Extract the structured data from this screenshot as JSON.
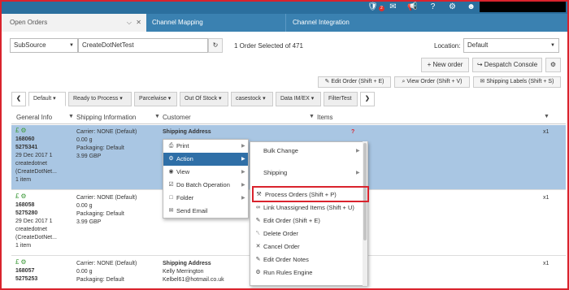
{
  "topbar": {
    "notifications_badge": "2",
    "icons": [
      "notifications-icon",
      "mail-icon",
      "megaphone-icon",
      "help-icon",
      "gear-icon",
      "user-icon"
    ]
  },
  "tabs": [
    {
      "label": "Open Orders"
    },
    {
      "label": "Channel Mapping"
    },
    {
      "label": "Channel Integration"
    }
  ],
  "filters": {
    "field_select": "SubSource",
    "search_value": "CreateDotNetTest",
    "selection_status": "1 Order Selected of 471",
    "location_label": "Location:",
    "location_value": "Default"
  },
  "toolbar": {
    "new_order": "New order",
    "despatch_console": "Despatch Console",
    "edit_order": "Edit Order (Shift + E)",
    "view_order": "View Order (Shift + V)",
    "shipping_labels": "Shipping Labels (Shift + S)"
  },
  "view_tabs": [
    "Default",
    "Ready to Process",
    "Parcelwise",
    "Out Of Stock",
    "casestock",
    "Data IM/EX",
    "FilterTest"
  ],
  "columns": [
    "General Info",
    "Shipping Information",
    "Customer",
    "Items"
  ],
  "orders": [
    {
      "id": "168060",
      "ref": "5275341",
      "date": "29 Dec 2017 1",
      "source": "createdotnet",
      "sub": "(CreateDotNet...",
      "items": "1 item",
      "carrier": "Carrier: NONE (Default)",
      "weight": "0.00 g",
      "packaging": "Packaging: Default",
      "price": "3.99 GBP",
      "customer_title": "Shipping Address",
      "customer_name": "",
      "customer_email": "",
      "qty": "x1"
    },
    {
      "id": "168058",
      "ref": "5275280",
      "date": "29 Dec 2017 1",
      "source": "createdotnet",
      "sub": "(CreateDotNet...",
      "items": "1 item",
      "carrier": "Carrier: NONE (Default)",
      "weight": "0.00 g",
      "packaging": "Packaging: Default",
      "price": "3.99 GBP",
      "customer_title": "",
      "customer_name": "",
      "customer_email": "",
      "qty": "x1"
    },
    {
      "id": "168057",
      "ref": "5275253",
      "date": "",
      "source": "",
      "sub": "",
      "items": "",
      "carrier": "Carrier: NONE (Default)",
      "weight": "0.00 g",
      "packaging": "Packaging: Default",
      "price": "",
      "customer_title": "Shipping Address",
      "customer_name": "Kelly Merrington",
      "customer_email": "Kelbel61@hotmail.co.uk",
      "qty": "x1"
    }
  ],
  "context_menu": [
    {
      "label": "Print",
      "icon": "printer-icon"
    },
    {
      "label": "Action",
      "icon": "gear-icon"
    },
    {
      "label": "View",
      "icon": "eye-icon"
    },
    {
      "label": "Do Batch Operation",
      "icon": "tasks-icon"
    },
    {
      "label": "Folder",
      "icon": "folder-icon"
    },
    {
      "label": "Send Email",
      "icon": "envelope-icon"
    }
  ],
  "action_submenu": [
    {
      "label": "Bulk Change",
      "icon": ""
    },
    {
      "label": "Shipping",
      "icon": ""
    },
    {
      "label": "Process Orders (Shift + P)",
      "icon": "gavel-icon"
    },
    {
      "label": "Link Unassigned Items (Shift + U)",
      "icon": "link-icon"
    },
    {
      "label": "Edit Order (Shift + E)",
      "icon": "pencil-icon"
    },
    {
      "label": "Delete Order",
      "icon": "trash-icon"
    },
    {
      "label": "Cancel Order",
      "icon": "times-icon"
    },
    {
      "label": "Edit Order Notes",
      "icon": "note-icon"
    },
    {
      "label": "Run Rules Engine",
      "icon": "cogs-icon"
    }
  ],
  "colors": {
    "topbar": "#2b6f9e",
    "tabs": "#3a81b1",
    "selected_row": "#a9c6e3",
    "highlight": "#2f6fa7",
    "annotation": "#d9232d"
  }
}
